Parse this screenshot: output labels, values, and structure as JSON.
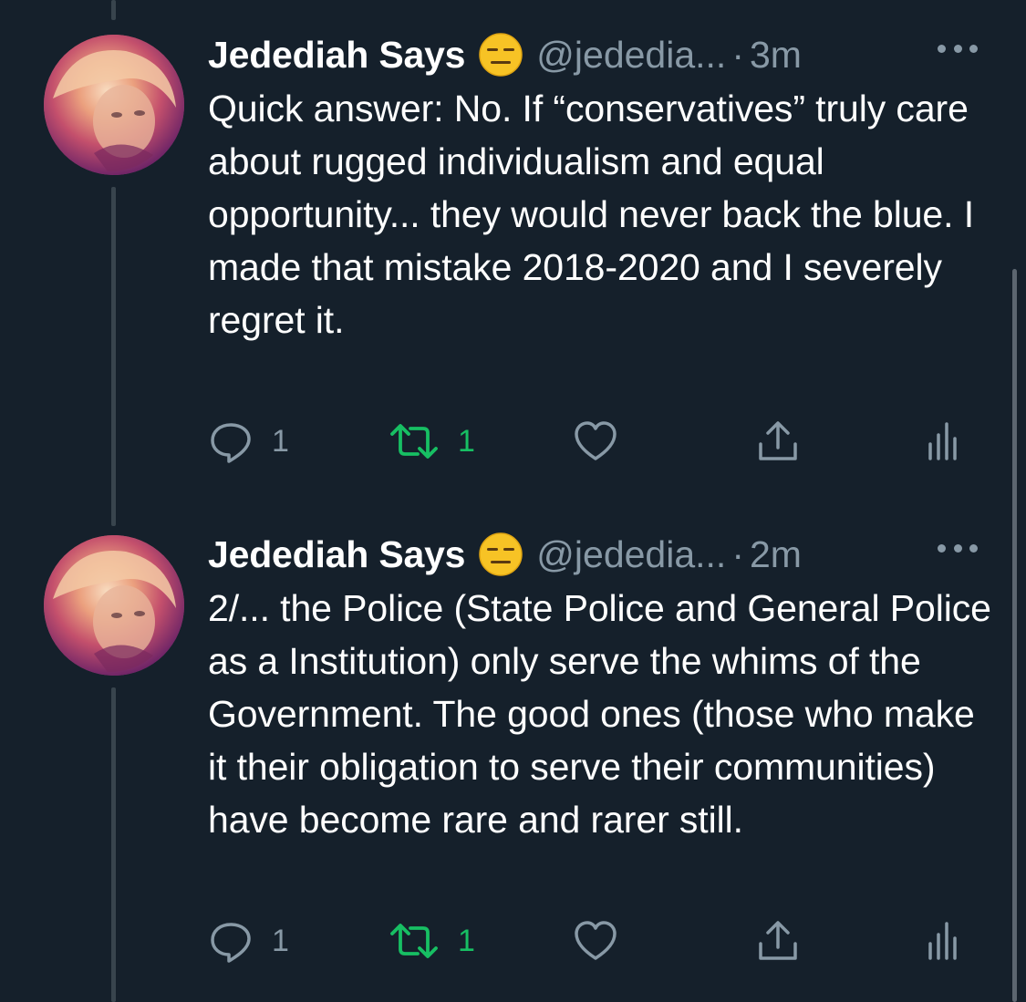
{
  "tweets": [
    {
      "display_name": "Jedediah Says",
      "handle": "@jededia...",
      "separator": "·",
      "time": "3m",
      "text": "Quick answer: No. If “conservatives” truly care about rugged individualism and equal opportunity... they would never back the blue. I made that mistake 2018-2020 and I severely regret it.",
      "reply_count": "1",
      "retweet_count": "1",
      "retweeted": true
    },
    {
      "display_name": "Jedediah Says",
      "handle": "@jededia...",
      "separator": "·",
      "time": "2m",
      "text": "2/... the Police (State Police and General Police as a Institution) only serve the whims of the Government. The good ones (those who make it their obligation to serve their communities) have become rare and rarer still.",
      "reply_count": "1",
      "retweet_count": "1",
      "retweeted": true
    }
  ],
  "colors": {
    "background": "#15202b",
    "secondary_text": "#8899a6",
    "retweet_active": "#17bf63",
    "thread_line": "#38444d"
  },
  "icons": {
    "name_emoji": "expressionless-face-icon",
    "more": "more-dots-icon",
    "reply": "reply-bubble-icon",
    "retweet": "retweet-icon",
    "like": "heart-icon",
    "share": "share-icon",
    "analytics": "analytics-bars-icon"
  }
}
